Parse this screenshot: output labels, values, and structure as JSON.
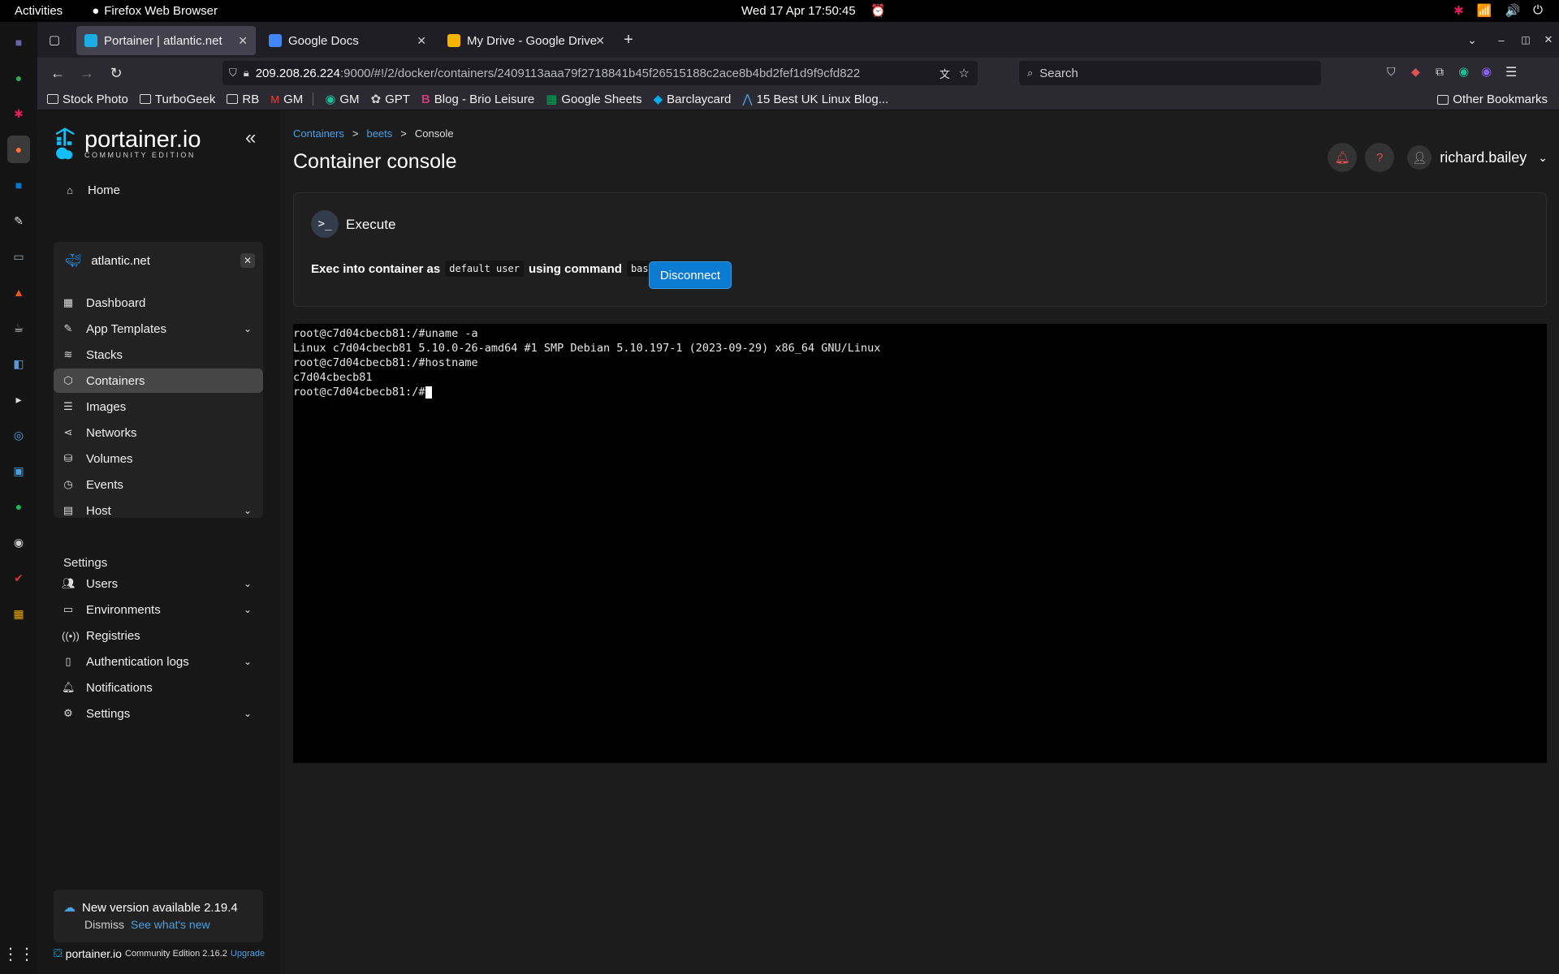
{
  "system_bar": {
    "activities": "Activities",
    "app_name": "Firefox Web Browser",
    "clock": "Wed 17 Apr  17:50:45"
  },
  "browser": {
    "tabs": [
      {
        "label": "Portainer | atlantic.net",
        "active": true,
        "color": "#1aaee5"
      },
      {
        "label": "Google Docs",
        "active": false,
        "color": "#4285f4"
      },
      {
        "label": "My Drive - Google Drive",
        "active": false,
        "color": "#f4b400"
      }
    ],
    "url_host": "209.208.26.224",
    "url_path": ":9000/#!/2/docker/containers/2409113aaa79f2718841b45f26515188c2ace8b4bd2fef1d9f9cfd822",
    "search_placeholder": "Search",
    "bookmarks": [
      {
        "label": "Stock Photo",
        "icon": "folder"
      },
      {
        "label": "TurboGeek",
        "icon": "folder"
      },
      {
        "label": "RB",
        "icon": "folder"
      },
      {
        "label": "GM",
        "icon": "gmail"
      },
      {
        "label": "GM",
        "icon": "grammarly"
      },
      {
        "label": "GPT",
        "icon": "openai"
      },
      {
        "label": "Blog - Brio Leisure",
        "icon": "brio"
      },
      {
        "label": "Google Sheets",
        "icon": "sheets"
      },
      {
        "label": "Barclaycard",
        "icon": "barclaycard"
      },
      {
        "label": "15 Best UK Linux Blog...",
        "icon": "blog"
      }
    ],
    "other_bookmarks": "Other Bookmarks"
  },
  "sidebar": {
    "logo_name": "portainer.io",
    "logo_edition": "COMMUNITY EDITION",
    "home": "Home",
    "environment": "atlantic.net",
    "env_items": [
      {
        "label": "Dashboard",
        "icon": "dashboard-icon",
        "chevron": false
      },
      {
        "label": "App Templates",
        "icon": "edit-icon",
        "chevron": true
      },
      {
        "label": "Stacks",
        "icon": "layers-icon",
        "chevron": false
      },
      {
        "label": "Containers",
        "icon": "box-icon",
        "chevron": false,
        "active": true
      },
      {
        "label": "Images",
        "icon": "list-icon",
        "chevron": false
      },
      {
        "label": "Networks",
        "icon": "share-icon",
        "chevron": false
      },
      {
        "label": "Volumes",
        "icon": "database-icon",
        "chevron": false
      },
      {
        "label": "Events",
        "icon": "clock-icon",
        "chevron": false
      },
      {
        "label": "Host",
        "icon": "server-icon",
        "chevron": true
      }
    ],
    "settings_title": "Settings",
    "settings_items": [
      {
        "label": "Users",
        "icon": "users-icon",
        "chevron": true
      },
      {
        "label": "Environments",
        "icon": "hdd-icon",
        "chevron": true
      },
      {
        "label": "Registries",
        "icon": "radio-icon",
        "chevron": false
      },
      {
        "label": "Authentication logs",
        "icon": "file-icon",
        "chevron": true
      },
      {
        "label": "Notifications",
        "icon": "bell-icon",
        "chevron": false
      },
      {
        "label": "Settings",
        "icon": "gear-icon",
        "chevron": true
      }
    ],
    "update_text": "New version available 2.19.4",
    "dismiss": "Dismiss",
    "whats_new": "See what's new",
    "footer_brand": "portainer.io",
    "footer_edition": "Community Edition 2.16.2",
    "footer_upgrade": "Upgrade"
  },
  "main": {
    "breadcrumb": [
      "Containers",
      "beets",
      "Console"
    ],
    "title": "Container console",
    "username": "richard.bailey",
    "panel_title": "Execute",
    "exec_prefix": "Exec into container as",
    "exec_user": "default user",
    "exec_mid": "using command",
    "exec_cmd": "bash",
    "disconnect": "Disconnect",
    "terminal_lines": [
      "root@c7d04cbecb81:/#uname -a",
      "Linux c7d04cbecb81 5.10.0-26-amd64 #1 SMP Debian 5.10.197-1 (2023-09-29) x86_64 GNU/Linux",
      "root@c7d04cbecb81:/#hostname",
      "c7d04cbecb81",
      "root@c7d04cbecb81:/#"
    ]
  },
  "colors": {
    "accent": "#0b7ad1",
    "link": "#4aa0e0",
    "sidebar_bg": "#171717",
    "active_nav": "#464646"
  }
}
